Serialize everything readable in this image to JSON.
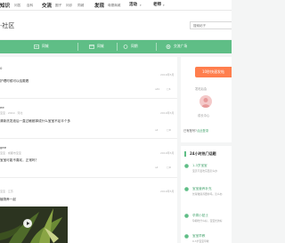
{
  "topnav": {
    "items": [
      {
        "label": "知识",
        "kind": "main"
      },
      {
        "label": "问答",
        "kind": "sub"
      },
      {
        "label": "百科",
        "kind": "sub"
      },
      {
        "label": "交流",
        "kind": "main"
      },
      {
        "label": "圈子",
        "kind": "sub"
      },
      {
        "label": "问诊",
        "kind": "sub"
      },
      {
        "label": "同城",
        "kind": "sub"
      },
      {
        "label": "发现",
        "kind": "main"
      },
      {
        "label": "母婴商城",
        "kind": "sub"
      },
      {
        "label": "活动",
        "kind": "main"
      },
      {
        "label": "老师",
        "kind": "main"
      }
    ]
  },
  "page": {
    "title": "·社区",
    "search_placeholder": "搜索帖子"
  },
  "tabs": [
    {
      "label": "同城"
    },
    {
      "label": "同城"
    },
    {
      "label": "同期"
    },
    {
      "label": "交流广场"
    }
  ],
  "posts": [
    {
      "user": "0",
      "text": "护理时候可以给戴着",
      "date": "2019年5月",
      "likes": "1",
      "comments": "1"
    },
    {
      "user": "ee",
      "meta": "宝宝 · 2019 · 河北",
      "text": "清新洗发液后一直过敏都掉成什么宝宝不足半个多",
      "date": "2019年5月",
      "likes": "",
      "comments": "0"
    },
    {
      "user": "gee",
      "meta": "宝宝 · 成都市宝宝",
      "text": "宝宝可能不喜欢，正常吗？",
      "date": "2019年5月",
      "likes": "",
      "comments": "0"
    },
    {
      "user": "",
      "meta": "宝宝 · 江苏",
      "text": "植物养一起",
      "date": "2019年5月",
      "likes": "",
      "comments": ""
    }
  ],
  "sidebar": {
    "publish_label": "10秒快速发帖",
    "hint": "发帖后会",
    "user_label": "成长中心",
    "login_text": "已有账号?",
    "login_link": "点此登录"
  },
  "hot": {
    "heading": "24小时热门话题",
    "items": [
      {
        "title": "1-3岁宝宝",
        "desc": "宝贝不爱吃东西怎么办"
      },
      {
        "title": "宝宝营养补充",
        "desc": "长得矮营养要补吗，怎么办"
      },
      {
        "title": "孕周小贴士",
        "desc": "孕期吃什么好，宝宝长的好"
      },
      {
        "title": "宝宝早教",
        "desc": "0-3岁宝宝早教"
      }
    ]
  },
  "colors": {
    "accent": "#5fbe86",
    "publish": "#ff7e4d",
    "hot_title": "#49a571"
  }
}
